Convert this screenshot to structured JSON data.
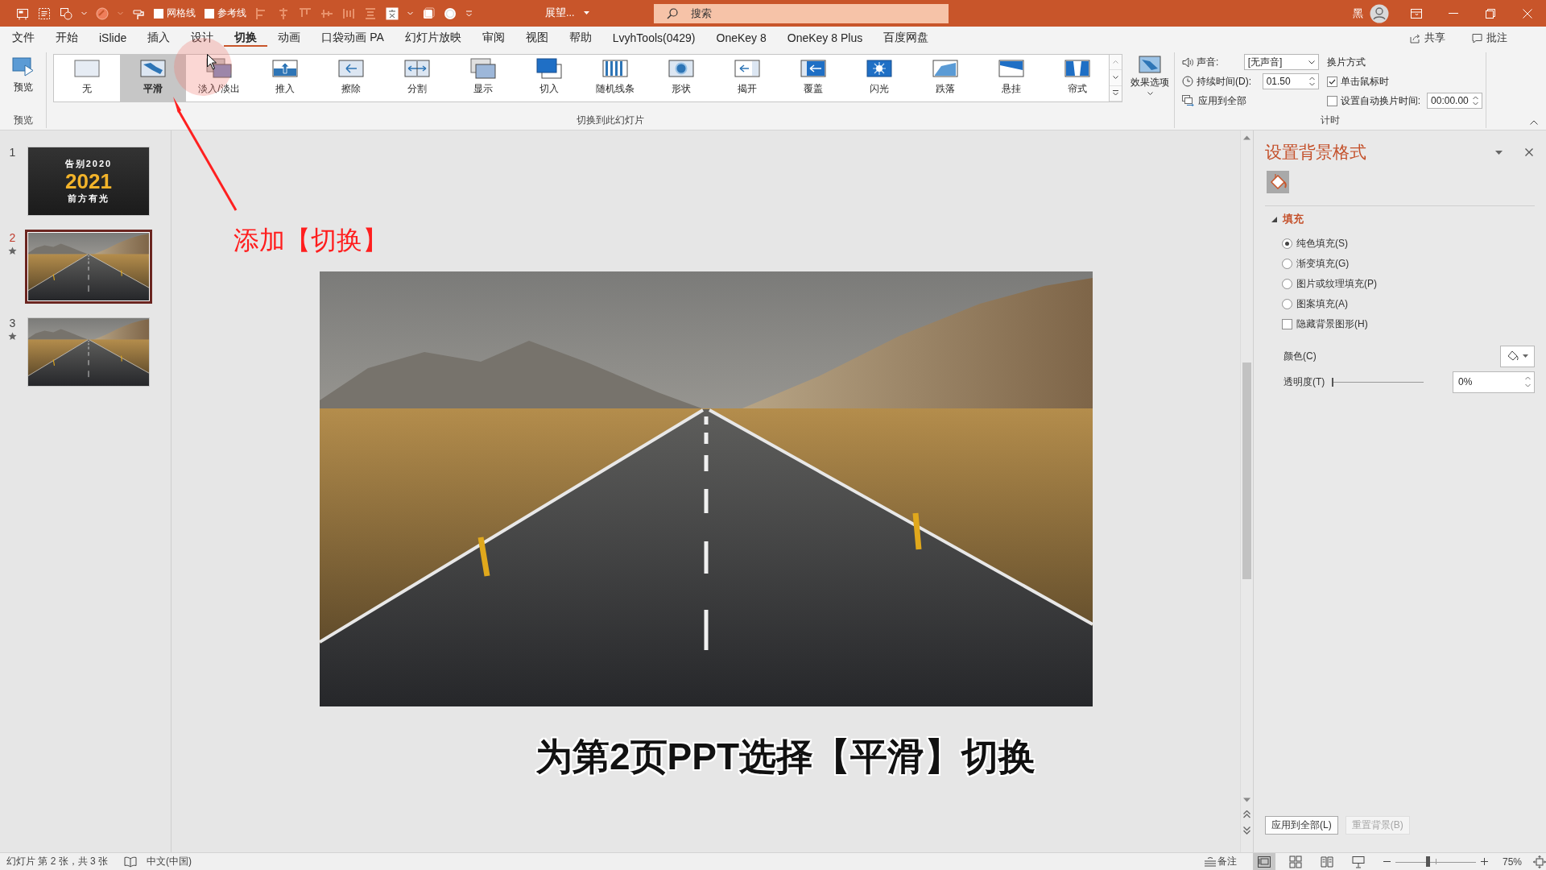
{
  "title_bar": {
    "toggles": [
      {
        "label": "网格线",
        "checked": false
      },
      {
        "label": "参考线",
        "checked": false
      }
    ],
    "document_title": "展望...",
    "search": {
      "placeholder": "搜索"
    },
    "user_name": "黑"
  },
  "menu": {
    "tabs": [
      {
        "label": "文件",
        "selected": false
      },
      {
        "label": "开始",
        "selected": false
      },
      {
        "label": "iSlide",
        "selected": false
      },
      {
        "label": "插入",
        "selected": false
      },
      {
        "label": "设计",
        "selected": false
      },
      {
        "label": "切换",
        "selected": true
      },
      {
        "label": "动画",
        "selected": false
      },
      {
        "label": "口袋动画 PA",
        "selected": false
      },
      {
        "label": "幻灯片放映",
        "selected": false
      },
      {
        "label": "审阅",
        "selected": false
      },
      {
        "label": "视图",
        "selected": false
      },
      {
        "label": "帮助",
        "selected": false
      },
      {
        "label": "LvyhTools(0429)",
        "selected": false
      },
      {
        "label": "OneKey 8",
        "selected": false
      },
      {
        "label": "OneKey 8 Plus",
        "selected": false
      },
      {
        "label": "百度网盘",
        "selected": false
      }
    ],
    "actions": [
      {
        "label": "共享"
      },
      {
        "label": "批注"
      }
    ]
  },
  "ribbon": {
    "preview": {
      "label": "预览",
      "group_label": "预览"
    },
    "transitions": {
      "items": [
        {
          "label": "无",
          "selected": false
        },
        {
          "label": "平滑",
          "selected": true
        },
        {
          "label": "淡入/淡出",
          "selected": false
        },
        {
          "label": "推入",
          "selected": false
        },
        {
          "label": "擦除",
          "selected": false
        },
        {
          "label": "分割",
          "selected": false
        },
        {
          "label": "显示",
          "selected": false
        },
        {
          "label": "切入",
          "selected": false
        },
        {
          "label": "随机线条",
          "selected": false
        },
        {
          "label": "形状",
          "selected": false
        },
        {
          "label": "揭开",
          "selected": false
        },
        {
          "label": "覆盖",
          "selected": false
        },
        {
          "label": "闪光",
          "selected": false
        },
        {
          "label": "跌落",
          "selected": false
        },
        {
          "label": "悬挂",
          "selected": false
        },
        {
          "label": "帘式",
          "selected": false
        }
      ],
      "effect_options": "效果选项",
      "group_label": "切换到此幻灯片"
    },
    "timing": {
      "sound": {
        "label": "声音:",
        "value": "[无声音]"
      },
      "duration": {
        "label": "持续时间(D):",
        "value": "01.50"
      },
      "apply_all": "应用到全部",
      "advance": {
        "label": "换片方式",
        "on_click": {
          "label": "单击鼠标时",
          "checked": true
        },
        "after": {
          "label": "设置自动换片时间:",
          "checked": false,
          "value": "00:00.00"
        }
      },
      "group_label": "计时"
    }
  },
  "slides": [
    {
      "number": "1",
      "kind": "title",
      "selected": false,
      "animated": false,
      "lines": [
        {
          "text": "告别2020",
          "kind": "caption"
        },
        {
          "text": "2021",
          "kind": "year"
        },
        {
          "text": "前方有光",
          "kind": "caption"
        }
      ]
    },
    {
      "number": "2",
      "kind": "photo",
      "selected": true,
      "animated": true
    },
    {
      "number": "3",
      "kind": "photo",
      "selected": false,
      "animated": true
    }
  ],
  "canvas": {
    "annotation": "添加【切换】",
    "subtitle": "为第2页PPT选择【平滑】切换"
  },
  "format_pane": {
    "title": "设置背景格式",
    "section": {
      "label": "填充",
      "expanded": true
    },
    "fill_options": [
      {
        "label": "纯色填充(S)",
        "selected": true
      },
      {
        "label": "渐变填充(G)",
        "selected": false
      },
      {
        "label": "图片或纹理填充(P)",
        "selected": false
      },
      {
        "label": "图案填充(A)",
        "selected": false
      }
    ],
    "hide_graphics": {
      "label": "隐藏背景图形(H)",
      "checked": false
    },
    "color_label": "颜色(C)",
    "transparency": {
      "label": "透明度(T)",
      "level": 0,
      "value": "0%"
    },
    "buttons": [
      {
        "label": "应用到全部(L)",
        "disabled": false
      },
      {
        "label": "重置背景(B)",
        "disabled": true
      }
    ]
  },
  "status_bar": {
    "slide_info": "幻灯片 第 2 张，共 3 张",
    "language": "中文(中国)",
    "notes": "备注",
    "views": [
      {
        "selected": true
      },
      {
        "selected": false
      },
      {
        "selected": false
      },
      {
        "selected": false
      }
    ],
    "zoom": {
      "level": 0.4,
      "value": "75%"
    }
  }
}
